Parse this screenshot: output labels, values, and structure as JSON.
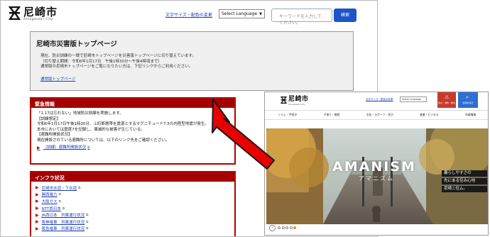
{
  "left_page": {
    "logo": {
      "title": "尼崎市",
      "subtitle": "Amagasaki City"
    },
    "header": {
      "util_link": "文字サイズ・配色の変更",
      "language_select": "Select Language",
      "search_placeholder": "キーワードを入力してください。",
      "search_button": "検索"
    },
    "top_box": {
      "title": "尼崎市災害版トップページ",
      "lines": [
        "現在、防災訓練の一環で尼崎市トップページを災害版トップページに切り替えています。",
        "（切り替え期間：令和6年1月17日　午後1時30分～午後4時頃まで）",
        "通常版の尼崎市トップページをご覧になりたい方は、下記リンクからご利用ください。"
      ],
      "link": "通常版トップページ"
    },
    "emergency": {
      "title": "緊急情報",
      "lines": [
        "「1.17は忘れない」地域防災訓練を実施します。",
        "【訓練想定】",
        "令和6年1月17日午後1時30分、上町断層帯を震源とするマグニチュード7.5の内陸型地震が発生。",
        "本市においては震度7を記録し、壊滅的な被害が生じている。",
        "【避難所開設状況】",
        "現在開設されている避難所については、以下のリンク先をご確認ください。"
      ],
      "link": "（訓練）避難所開設状況"
    },
    "infra": {
      "title": "インフラ状況",
      "items": [
        "尼崎市水道・下水道",
        "関西電力",
        "大阪ガス",
        "NTT西日本",
        "JR西日本　列車運行状況",
        "阪神電車　列車運行状況",
        "阪急電車　列車運行状況"
      ]
    }
  },
  "right_page": {
    "logo": {
      "title": "尼崎市",
      "subtitle": "Amagasaki City"
    },
    "util_link": "文字サイズ・配色の変更",
    "language_select": "Select Language",
    "emergency_button": "防災・消防・救急",
    "info_button": "情報を探す",
    "nav": [
      "くらし・手続き",
      "子育て・教育",
      "文化・スポーツ・学び",
      "産業・ビジネス",
      "市政情報"
    ],
    "hero": {
      "headline": "AMANISM",
      "kana": "アマニズム",
      "copy": [
        "暮らしやすさの",
        "先にある住み心地",
        "尼崎ニ住ム。"
      ]
    },
    "carousel": {
      "prev": "‹",
      "dot_count": 5,
      "active_index": 4
    }
  },
  "colors": {
    "accent_red": "#a40000",
    "link_blue": "#1a3db5",
    "search_blue": "#1d55c8",
    "arrow_red": "#e80000"
  }
}
